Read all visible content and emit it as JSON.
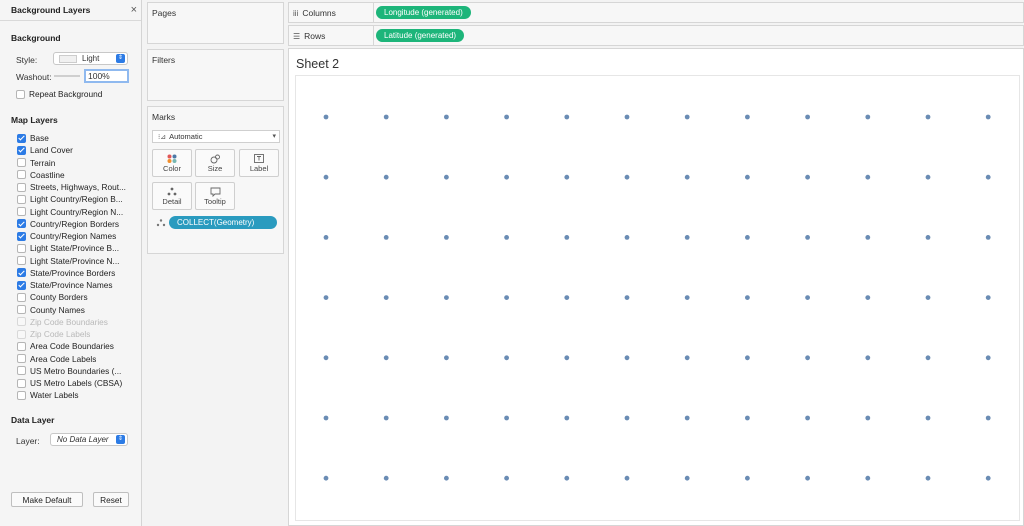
{
  "background_panel": {
    "title": "Background Layers",
    "close_glyph": "×",
    "background_section": "Background",
    "style_label": "Style:",
    "style_value": "Light",
    "washout_label": "Washout:",
    "washout_value": "100%",
    "repeat_label": "Repeat Background",
    "map_layers_section": "Map Layers",
    "map_layers": [
      {
        "label": "Base",
        "checked": true,
        "disabled": false
      },
      {
        "label": "Land Cover",
        "checked": true,
        "disabled": false
      },
      {
        "label": "Terrain",
        "checked": false,
        "disabled": false
      },
      {
        "label": "Coastline",
        "checked": false,
        "disabled": false
      },
      {
        "label": "Streets, Highways, Rout...",
        "checked": false,
        "disabled": false
      },
      {
        "label": "Light Country/Region B...",
        "checked": false,
        "disabled": false
      },
      {
        "label": "Light Country/Region N...",
        "checked": false,
        "disabled": false
      },
      {
        "label": "Country/Region Borders",
        "checked": true,
        "disabled": false
      },
      {
        "label": "Country/Region Names",
        "checked": true,
        "disabled": false
      },
      {
        "label": "Light State/Province B...",
        "checked": false,
        "disabled": false
      },
      {
        "label": "Light State/Province N...",
        "checked": false,
        "disabled": false
      },
      {
        "label": "State/Province Borders",
        "checked": true,
        "disabled": false
      },
      {
        "label": "State/Province Names",
        "checked": true,
        "disabled": false
      },
      {
        "label": "County Borders",
        "checked": false,
        "disabled": false
      },
      {
        "label": "County Names",
        "checked": false,
        "disabled": false
      },
      {
        "label": "Zip Code Boundaries",
        "checked": false,
        "disabled": true
      },
      {
        "label": "Zip Code Labels",
        "checked": false,
        "disabled": true
      },
      {
        "label": "Area Code Boundaries",
        "checked": false,
        "disabled": false
      },
      {
        "label": "Area Code Labels",
        "checked": false,
        "disabled": false
      },
      {
        "label": "US Metro Boundaries (...",
        "checked": false,
        "disabled": false
      },
      {
        "label": "US Metro Labels (CBSA)",
        "checked": false,
        "disabled": false
      },
      {
        "label": "Water Labels",
        "checked": false,
        "disabled": false
      }
    ],
    "data_layer_section": "Data Layer",
    "layer_label": "Layer:",
    "layer_value": "No Data Layer",
    "make_default_label": "Make Default",
    "reset_label": "Reset"
  },
  "cards": {
    "pages_title": "Pages",
    "filters_title": "Filters",
    "marks_title": "Marks",
    "mark_type": "Automatic",
    "tiles": [
      {
        "name": "color",
        "label": "Color"
      },
      {
        "name": "size",
        "label": "Size"
      },
      {
        "name": "label",
        "label": "Label"
      },
      {
        "name": "detail",
        "label": "Detail"
      },
      {
        "name": "tooltip",
        "label": "Tooltip"
      }
    ],
    "detail_pill": "COLLECT(Geometry)"
  },
  "shelves": {
    "columns_label": "Columns",
    "columns_pill": "Longitude (generated)",
    "rows_label": "Rows",
    "rows_pill": "Latitude (generated)"
  },
  "sheet": {
    "title": "Sheet 2",
    "dot_color": "#6a8cb4",
    "grid_rows": 7,
    "grid_cols": 12
  },
  "colors": {
    "accent_blue": "#2c7be5",
    "pill_green": "#1db57a",
    "pill_blue": "#2a9bbf"
  }
}
